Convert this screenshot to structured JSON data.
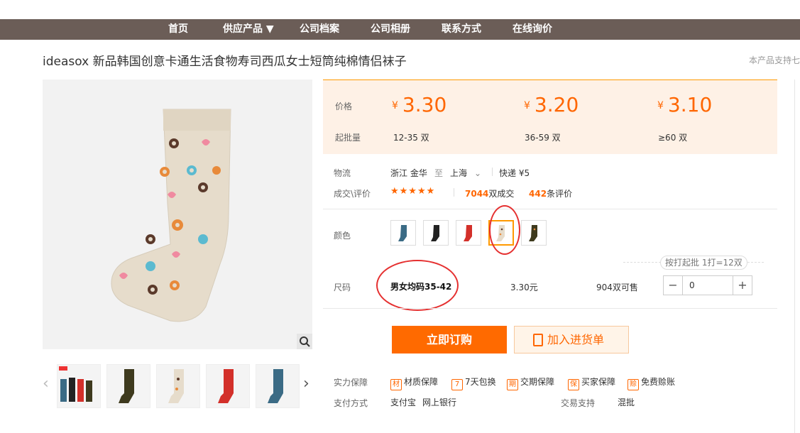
{
  "nav": {
    "items": [
      "首页",
      "供应产品 ▼",
      "公司档案",
      "公司相册",
      "联系方式",
      "在线询价"
    ]
  },
  "product": {
    "title": "ideasox 新品韩国创意卡通生活食物寿司西瓜女士短筒纯棉情侣袜子",
    "support_note": "本产品支持七"
  },
  "price_block": {
    "price_label": "价格",
    "moq_label": "起批量",
    "currency": "¥",
    "tiers": [
      {
        "price": "3.30",
        "moq": "12-35 双"
      },
      {
        "price": "3.20",
        "moq": "36-59 双"
      },
      {
        "price": "3.10",
        "moq": "≥60 双"
      }
    ]
  },
  "logistics": {
    "label": "物流",
    "from": "浙江 金华",
    "to_word": "至",
    "to": "上海",
    "express": "快递 ¥5"
  },
  "deal": {
    "label": "成交\\评价",
    "stars": "★★★★★",
    "count_num": "7044",
    "count_suffix": "双成交",
    "reviews_num": "442",
    "reviews_suffix": "条评价"
  },
  "color": {
    "label": "颜色",
    "swatches": [
      "blue-sock",
      "black-sock",
      "red-sock",
      "beige-sock",
      "olive-sock"
    ],
    "selected_index": 3
  },
  "pack": {
    "note": "按打起批 1打=12双"
  },
  "size": {
    "label": "尺码",
    "value": "男女均码35-42",
    "unit_price": "3.30元",
    "stock": "904双可售",
    "qty": "0",
    "minus": "−",
    "plus": "+"
  },
  "actions": {
    "buy_label": "立即订购",
    "cart_label": "加入进货单"
  },
  "guarantee": {
    "label": "实力保障",
    "items": [
      {
        "icon": "材",
        "text": "材质保障"
      },
      {
        "icon": "7",
        "text": "7天包换"
      },
      {
        "icon": "期",
        "text": "交期保障"
      },
      {
        "icon": "保",
        "text": "买家保障"
      },
      {
        "icon": "赊",
        "text": "免费赊账"
      }
    ]
  },
  "payment": {
    "label": "支付方式",
    "methods": [
      "支付宝",
      "网上银行"
    ]
  },
  "trade": {
    "label": "交易支持",
    "value": "混批"
  },
  "colors": {
    "nav_bg": "#6b5d57",
    "accent": "#ff6a00",
    "price_bg": "#fef1e6",
    "highlight_ring": "#e53030"
  }
}
